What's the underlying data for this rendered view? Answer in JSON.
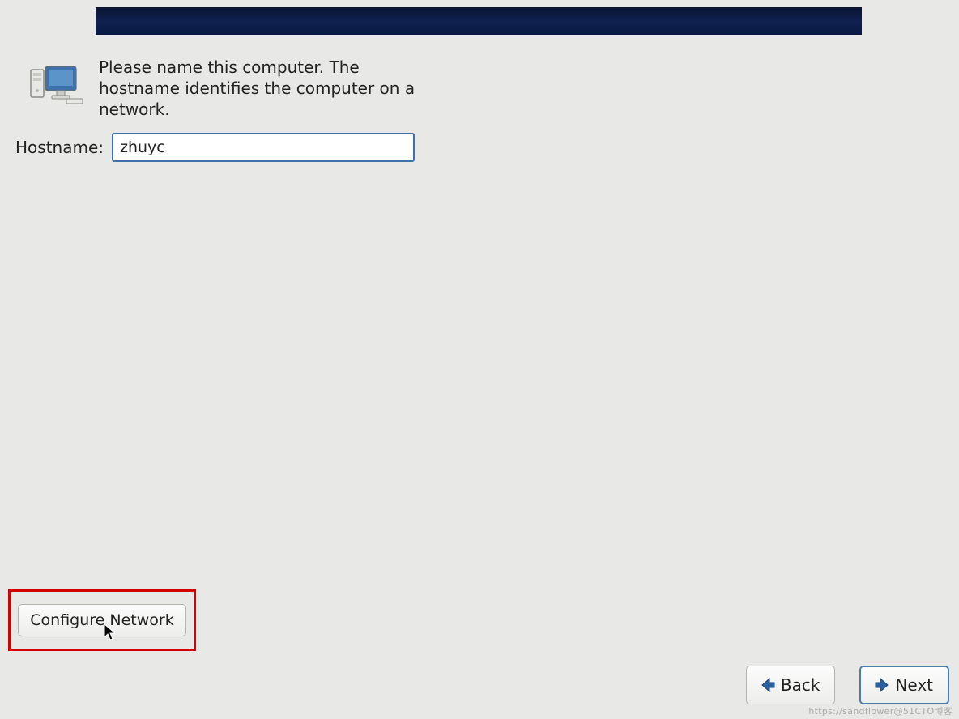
{
  "description": "Please name this computer.  The hostname identifies the computer on a network.",
  "hostname": {
    "label": "Hostname:",
    "value": "zhuyc"
  },
  "buttons": {
    "configure_network": "Configure Network",
    "back": "Back",
    "next": "Next"
  },
  "watermark": "https://sandflower@51CTO博客"
}
